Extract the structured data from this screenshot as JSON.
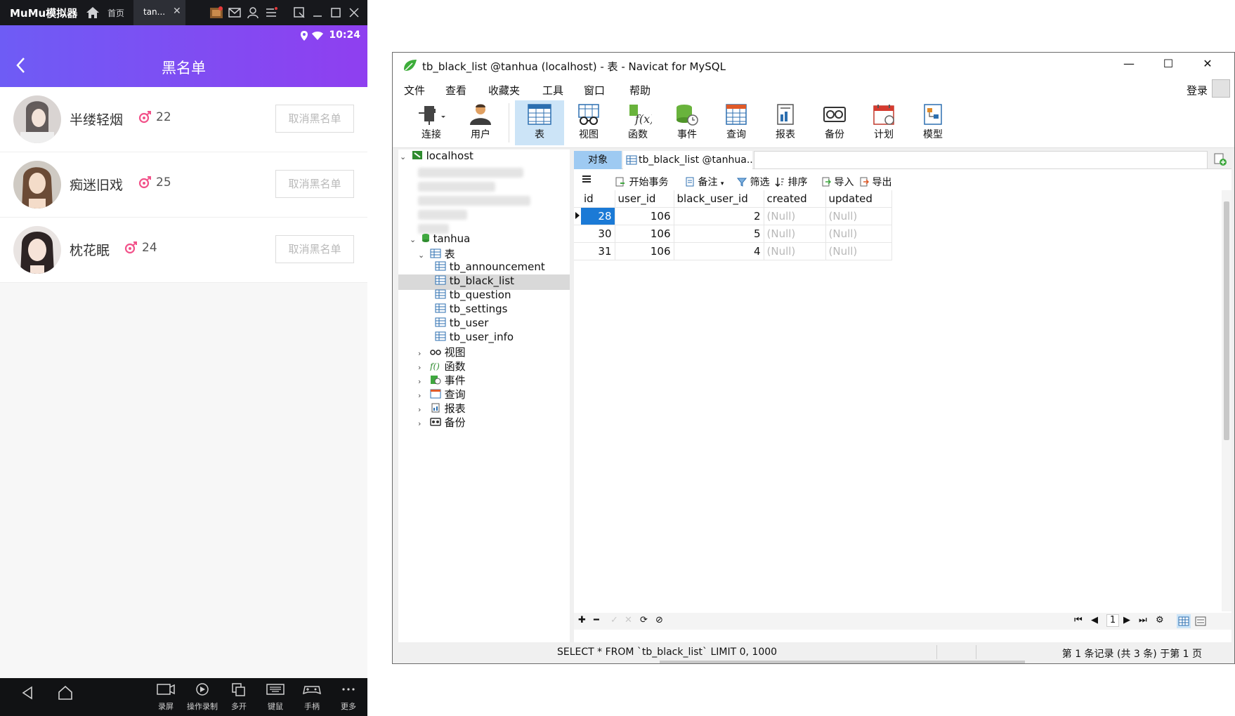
{
  "mumu": {
    "app_name": "MuMu模拟器",
    "home_label": "首页",
    "tab_label": "tan...",
    "status_time": "10:24",
    "page_title": "黑名单",
    "users": [
      {
        "name": "半缕轻烟",
        "age": "22",
        "button": "取消黑名单"
      },
      {
        "name": "痴迷旧戏",
        "age": "25",
        "button": "取消黑名单"
      },
      {
        "name": "枕花眠",
        "age": "24",
        "button": "取消黑名单"
      }
    ],
    "tools": [
      {
        "label": "录屏",
        "icon": "record-screen-icon"
      },
      {
        "label": "操作录制",
        "icon": "macro-record-icon"
      },
      {
        "label": "多开",
        "icon": "multi-instance-icon"
      },
      {
        "label": "键鼠",
        "icon": "keyboard-icon"
      },
      {
        "label": "手柄",
        "icon": "gamepad-icon"
      },
      {
        "label": "更多",
        "icon": "more-icon"
      }
    ],
    "colors": {
      "header_start": "#6e5cf5",
      "header_end": "#8f3ff0",
      "gender": "#f2528a"
    }
  },
  "navicat": {
    "window_title": "tb_black_list @tanhua (localhost) - 表 - Navicat for MySQL",
    "menu": [
      "文件",
      "查看",
      "收藏夹",
      "工具",
      "窗口",
      "帮助"
    ],
    "login": "登录",
    "toolbar": [
      "连接",
      "用户",
      "表",
      "视图",
      "函数",
      "事件",
      "查询",
      "报表",
      "备份",
      "计划",
      "模型"
    ],
    "tree": {
      "connection": "localhost",
      "database": "tanhua",
      "tables_group": "表",
      "tables": [
        "tb_announcement",
        "tb_black_list",
        "tb_question",
        "tb_settings",
        "tb_user",
        "tb_user_info"
      ],
      "groups": [
        "视图",
        "函数",
        "事件",
        "查询",
        "报表",
        "备份"
      ]
    },
    "tabs": {
      "objects": "对象",
      "table": "tb_black_list @tanhua..."
    },
    "grid_toolbar": {
      "begin_tx": "开始事务",
      "memo": "备注",
      "filter": "筛选",
      "sort": "排序",
      "import": "导入",
      "export": "导出"
    },
    "grid": {
      "columns": [
        "id",
        "user_id",
        "black_user_id",
        "created",
        "updated"
      ],
      "rows": [
        [
          "28",
          "106",
          "2",
          "(Null)",
          "(Null)"
        ],
        [
          "30",
          "106",
          "5",
          "(Null)",
          "(Null)"
        ],
        [
          "31",
          "106",
          "4",
          "(Null)",
          "(Null)"
        ]
      ]
    },
    "page_number": "1",
    "status": {
      "sql": "SELECT * FROM `tb_black_list` LIMIT 0, 1000",
      "info": "第 1 条记录 (共 3 条) 于第 1 页"
    },
    "colors": {
      "selected_cell": "#1b7ad6",
      "active_toolbar": "#cce4f7",
      "objects_tab": "#9ecaf2"
    }
  }
}
